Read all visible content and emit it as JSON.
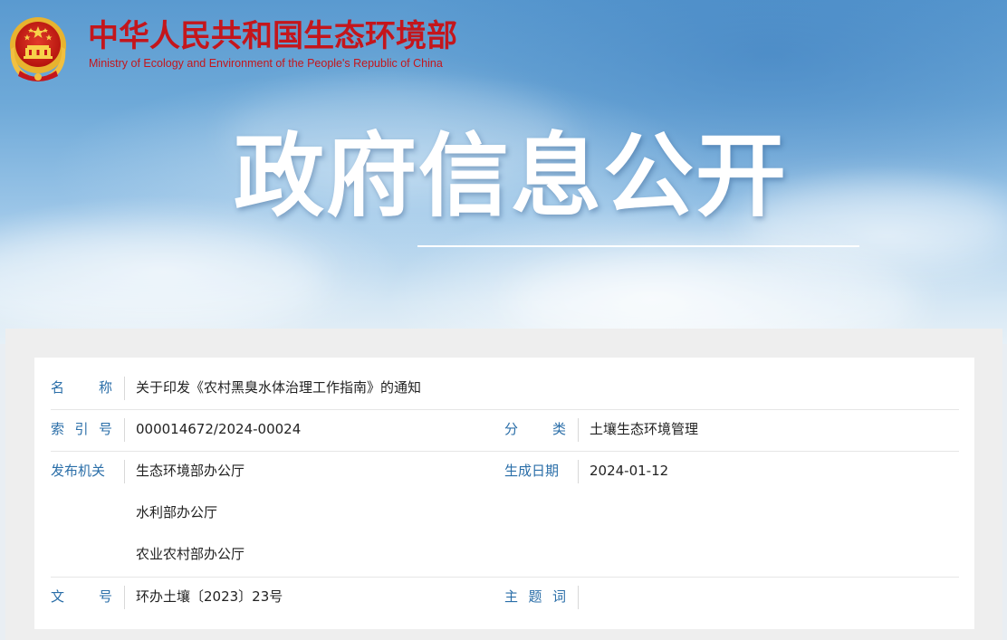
{
  "header": {
    "ministry_name_cn": "中华人民共和国生态环境部",
    "ministry_name_en": "Ministry of Ecology and Environment of the People's Republic of China",
    "brand_color": "#c4161c",
    "emblem_icon": "national-emblem-icon"
  },
  "banner": {
    "title": "政府信息公开"
  },
  "info": {
    "name": {
      "label": [
        "名",
        "称"
      ],
      "value": "关于印发《农村黑臭水体治理工作指南》的通知"
    },
    "index": {
      "label": [
        "索",
        "引",
        "号"
      ],
      "value": "000014672/2024-00024"
    },
    "category": {
      "label": [
        "分",
        "类"
      ],
      "value": "土壤生态环境管理"
    },
    "issuer": {
      "label": [
        "发布机关"
      ],
      "values": [
        "生态环境部办公厅",
        "水利部办公厅",
        "农业农村部办公厅"
      ]
    },
    "date": {
      "label": [
        "生成日期"
      ],
      "value": "2024-01-12"
    },
    "doc_number": {
      "label": [
        "文",
        "号"
      ],
      "value": "环办土壤〔2023〕23号"
    },
    "subject": {
      "label": [
        "主",
        "题",
        "词"
      ],
      "value": ""
    },
    "label_color": "#2a6ea8"
  }
}
